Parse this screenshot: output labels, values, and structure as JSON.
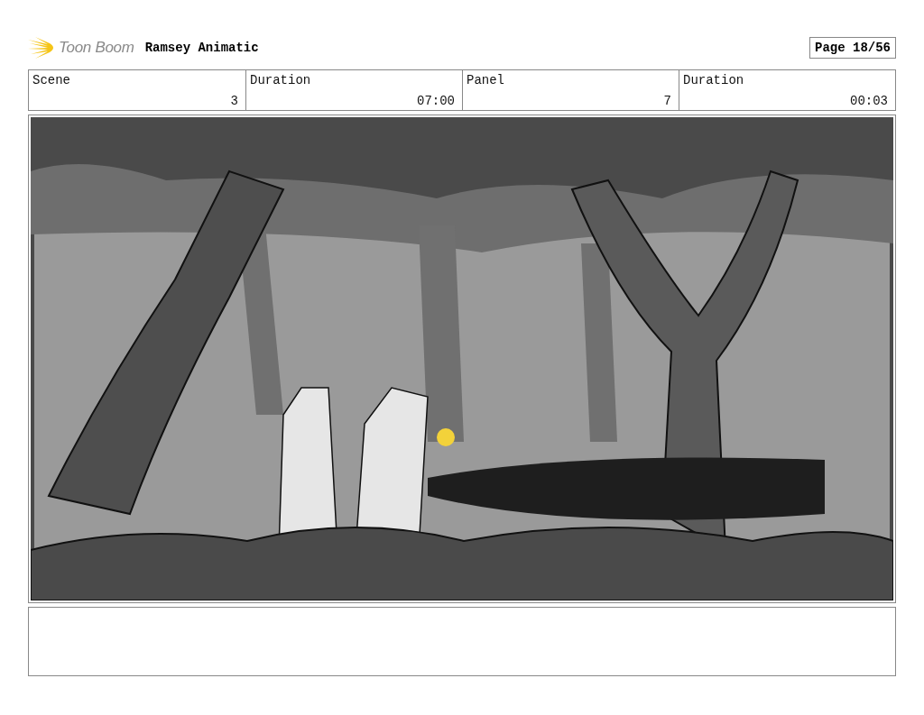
{
  "header": {
    "logo_text": "Toon Boom",
    "project_title": "Ramsey Animatic",
    "page": "Page 18/56"
  },
  "info_cells": [
    {
      "label": "Scene",
      "value": "3"
    },
    {
      "label": "Duration",
      "value": "07:00"
    },
    {
      "label": "Panel",
      "value": "7"
    },
    {
      "label": "Duration",
      "value": "00:03"
    }
  ]
}
